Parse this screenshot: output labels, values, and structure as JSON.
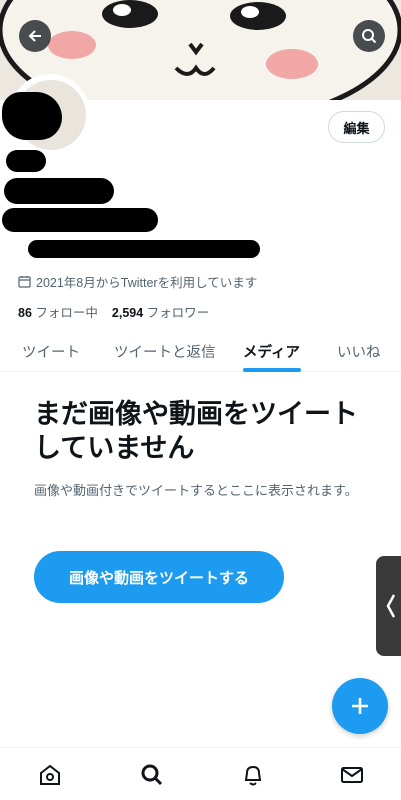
{
  "header": {
    "back_icon": "arrow-left-icon",
    "search_icon": "search-icon"
  },
  "profile": {
    "edit_label": "編集",
    "joined_text": "2021年8月からTwitterを利用しています",
    "following_count": "86",
    "following_label": "フォロー中",
    "followers_count": "2,594",
    "followers_label": "フォロワー"
  },
  "tabs": [
    {
      "label": "ツイート",
      "active": false
    },
    {
      "label": "ツイートと返信",
      "active": false
    },
    {
      "label": "メディア",
      "active": true
    },
    {
      "label": "いいね",
      "active": false
    }
  ],
  "media_empty": {
    "title": "まだ画像や動画をツイートしていません",
    "subtitle": "画像や動画付きでツイートするとここに表示されます。",
    "button_label": "画像や動画をツイートする"
  },
  "colors": {
    "accent": "#1d9bf0",
    "text": "#0f1419",
    "muted": "#536471"
  },
  "bottom_nav": [
    "home-icon",
    "search-icon",
    "notifications-icon",
    "messages-icon"
  ]
}
